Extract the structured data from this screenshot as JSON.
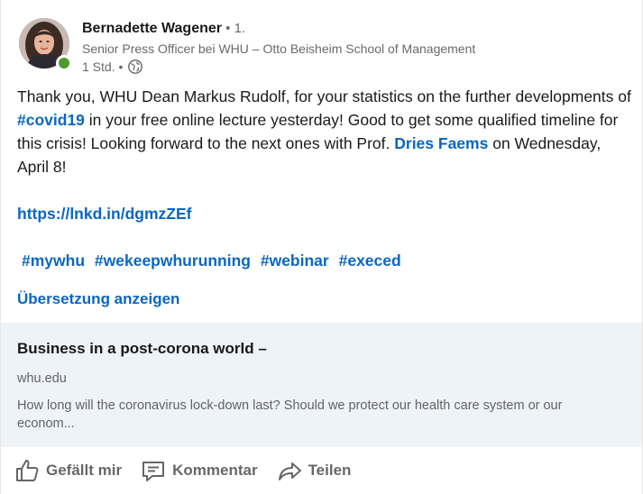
{
  "post": {
    "author_name": "Bernadette Wagener",
    "degree": " • 1.",
    "author_title": "Senior Press Officer bei WHU – Otto Beisheim School of Management",
    "timestamp": "1 Std. •",
    "visibility_icon": "globe-icon",
    "presence_color": "#4e9a2d",
    "text_part1": "Thank you, WHU Dean Markus Rudolf, for your statistics on the further developments of  ",
    "hashtag_covid": "#covid19",
    "text_part2": " in your free online lecture yesterday! Good to get some qualified timeline for this crisis! Looking forward to the next ones with Prof. ",
    "mention": "Dries Faems",
    "text_part3": " on Wednesday, April 8!",
    "short_link": "https://lnkd.in/dgmzZEf",
    "hashtags": [
      "#mywhu",
      "#wekeepwhurunning",
      "#webinar",
      "#execed"
    ],
    "translate_label": "Übersetzung anzeigen"
  },
  "preview": {
    "title": "Business in a post-corona world –",
    "domain": "whu.edu",
    "description": "How long will the coronavirus lock-down last? Should we protect our health care system or our econom..."
  },
  "actions": {
    "like_label": "Gefällt mir",
    "like_icon": "thumbs-up-icon",
    "comment_label": "Kommentar",
    "comment_icon": "comment-icon",
    "share_label": "Teilen",
    "share_icon": "share-arrow-icon"
  },
  "colors": {
    "link": "#0a66c2",
    "preview_bg": "#eef3f8"
  }
}
